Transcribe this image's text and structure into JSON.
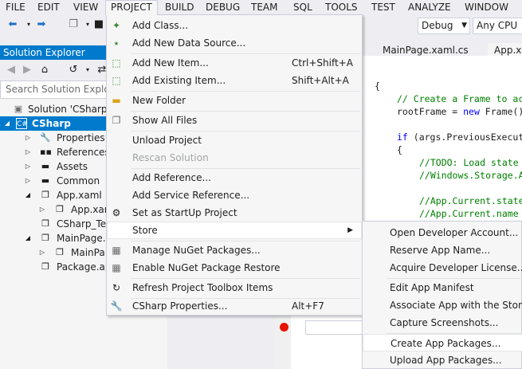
{
  "menubar": [
    "FILE",
    "EDIT",
    "VIEW",
    "PROJECT",
    "BUILD",
    "DEBUG",
    "TEAM",
    "SQL",
    "TOOLS",
    "TEST",
    "ANALYZE",
    "WINDOW"
  ],
  "toolbar": {
    "config": "Debug",
    "platform": "Any CPU"
  },
  "solution_explorer": {
    "title": "Solution Explorer",
    "search_placeholder": "Search Solution Explore",
    "tree": [
      "Solution 'CSharp'",
      "CSharp",
      "Properties",
      "References",
      "Assets",
      "Common",
      "App.xaml",
      "App.xar",
      "CSharp_Ter",
      "MainPage.x",
      "MainPa",
      "Package.ap"
    ]
  },
  "tabs": {
    "tab1": "MainPage.xaml.cs",
    "tab2": "App.xa"
  },
  "code": {
    "brace": "{",
    "c1": "// Create a Frame to ac",
    "c2_pre": "rootFrame = ",
    "c2_kw": "new",
    "c2_post": " Frame()",
    "c3_kw": "if",
    "c3_post": " (args.PreviousExecut",
    "c4": "{",
    "c5": "//TODO: Load state",
    "c6": "//Windows.Storage.A",
    "c7": "//App.Current.state",
    "c8": "//App.Current.name"
  },
  "project_menu": {
    "items": [
      {
        "label": "Add Class...",
        "icon": "class-icon",
        "shortcut": ""
      },
      {
        "label": "Add New Data Source...",
        "icon": "datasource-icon",
        "shortcut": ""
      },
      {
        "label": "Add New Item...",
        "icon": "new-item-icon",
        "shortcut": "Ctrl+Shift+A"
      },
      {
        "label": "Add Existing Item...",
        "icon": "existing-item-icon",
        "shortcut": "Shift+Alt+A"
      },
      {
        "label": "New Folder",
        "icon": "folder-icon",
        "shortcut": ""
      },
      {
        "label": "Show All Files",
        "icon": "files-icon",
        "shortcut": ""
      },
      {
        "label": "Unload Project",
        "icon": "",
        "shortcut": ""
      },
      {
        "label": "Rescan Solution",
        "icon": "",
        "shortcut": ""
      },
      {
        "label": "Add Reference...",
        "icon": "",
        "shortcut": ""
      },
      {
        "label": "Add Service Reference...",
        "icon": "",
        "shortcut": ""
      },
      {
        "label": "Set as StartUp Project",
        "icon": "gear-icon",
        "shortcut": ""
      },
      {
        "label": "Store",
        "icon": "",
        "shortcut": ""
      },
      {
        "label": "Manage NuGet Packages...",
        "icon": "nuget-icon",
        "shortcut": ""
      },
      {
        "label": "Enable NuGet Package Restore",
        "icon": "restore-icon",
        "shortcut": ""
      },
      {
        "label": "Refresh Project Toolbox Items",
        "icon": "refresh-icon",
        "shortcut": ""
      },
      {
        "label": "CSharp Properties...",
        "icon": "wrench-icon",
        "shortcut": "Alt+F7"
      }
    ]
  },
  "store_menu": {
    "items": [
      "Open Developer Account...",
      "Reserve App Name...",
      "Acquire Developer License...",
      "Edit App Manifest",
      "Associate App with the Store...",
      "Capture Screenshots...",
      "Create App Packages...",
      "Upload App Packages..."
    ]
  },
  "colors": {
    "accent": "#007acc",
    "menu_bg": "#f6f6f6",
    "breakpoint": "#e51400"
  }
}
